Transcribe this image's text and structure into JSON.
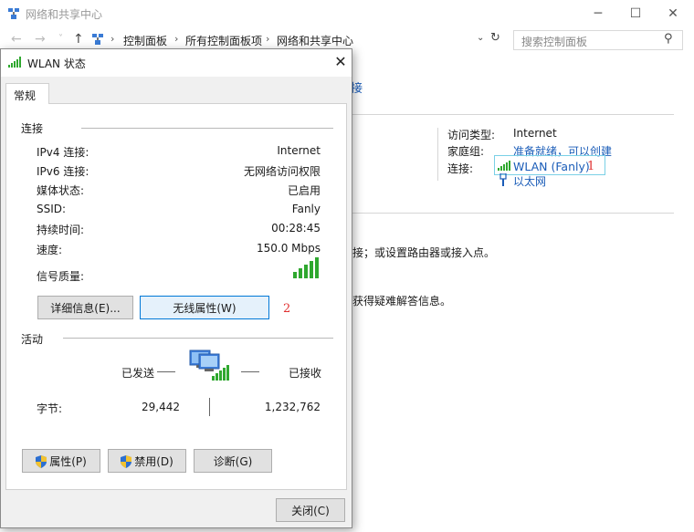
{
  "background": {
    "window_title": "网络和共享中心",
    "controls": {
      "minimize": "─",
      "maximize": "☐",
      "close": "✕"
    },
    "nav": {
      "back": "←",
      "forward": "→",
      "recent": "˅",
      "up": "↑"
    },
    "breadcrumb": [
      "控制面板",
      "所有控制面板项",
      "网络和共享中心"
    ],
    "breadcrumb_sep": "›",
    "address_dropdown": "⌄",
    "refresh": "↻",
    "search_placeholder": "搜索控制面板",
    "search_glyph": "⚲",
    "link_fragment": "接",
    "access_type_label": "访问类型:",
    "access_type_value": "Internet",
    "homegroup_label": "家庭组:",
    "homegroup_value": "准备就绪，可以创建",
    "connections_label": "连接:",
    "connection_wlan": "WLAN (Fanly)",
    "connection_ethernet": "以太网",
    "task_text_1": "接；或设置路由器或接入点。",
    "task_text_2": "获得疑难解答信息。"
  },
  "annotations": {
    "one": "1",
    "two": "2"
  },
  "dialog": {
    "title": "WLAN 状态",
    "close_glyph": "✕",
    "tab": "常规",
    "connection_group": "连接",
    "rows": [
      {
        "label": "IPv4 连接:",
        "value": "Internet"
      },
      {
        "label": "IPv6 连接:",
        "value": "无网络访问权限"
      },
      {
        "label": "媒体状态:",
        "value": "已启用"
      },
      {
        "label": "SSID:",
        "value": "Fanly"
      },
      {
        "label": "持续时间:",
        "value": "00:28:45"
      },
      {
        "label": "速度:",
        "value": "150.0 Mbps"
      }
    ],
    "signal_label": "信号质量:",
    "details_button": "详细信息(E)...",
    "wireless_props_button": "无线属性(W)",
    "activity_group": "活动",
    "sent_label": "已发送",
    "received_label": "已接收",
    "bytes_label": "字节:",
    "bytes_sent": "29,442",
    "bytes_received": "1,232,762",
    "properties_button": "属性(P)",
    "disable_button": "禁用(D)",
    "diagnose_button": "诊断(G)",
    "close_button": "关闭(C)"
  },
  "colors": {
    "link": "#1a5cb8",
    "signal": "#2fa82f",
    "annotation": "#e03030",
    "focus": "#0078d7"
  }
}
